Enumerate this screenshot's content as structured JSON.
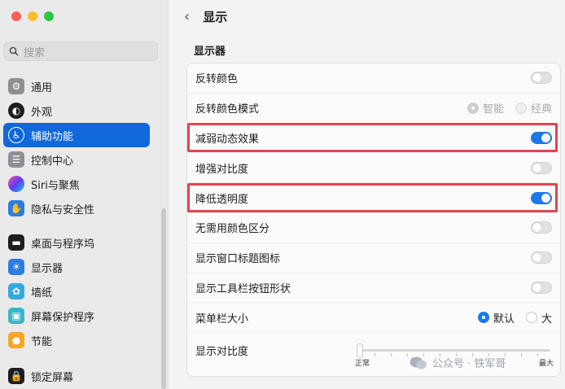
{
  "sidebar": {
    "search_placeholder": "搜索",
    "items": [
      {
        "label": "通用",
        "icon": "gear-icon",
        "color": "#8e8e93"
      },
      {
        "label": "外观",
        "icon": "appearance-icon",
        "color": "#1d1d1f"
      },
      {
        "label": "辅助功能",
        "icon": "accessibility-icon",
        "color": "#1068d9"
      },
      {
        "label": "控制中心",
        "icon": "control-center-icon",
        "color": "#8e8e93"
      },
      {
        "label": "Siri与聚焦",
        "icon": "siri-icon",
        "color": "#6a3fd6"
      },
      {
        "label": "隐私与安全性",
        "icon": "hand-icon",
        "color": "#2a7de1"
      },
      {
        "label": "桌面与程序坞",
        "icon": "dock-icon",
        "color": "#1d1d1f"
      },
      {
        "label": "显示器",
        "icon": "display-icon",
        "color": "#2a7de1"
      },
      {
        "label": "墙纸",
        "icon": "wallpaper-icon",
        "color": "#33aadd"
      },
      {
        "label": "屏幕保护程序",
        "icon": "screensaver-icon",
        "color": "#39b6c9"
      },
      {
        "label": "节能",
        "icon": "bulb-icon",
        "color": "#f5a623"
      },
      {
        "label": "锁定屏幕",
        "icon": "lock-icon",
        "color": "#1d1d1f"
      }
    ],
    "active_index": 2
  },
  "header": {
    "title": "显示"
  },
  "section": {
    "label": "显示器"
  },
  "rows": [
    {
      "label": "反转颜色",
      "type": "toggle",
      "on": false
    },
    {
      "label": "反转颜色模式",
      "type": "radio",
      "options": [
        "智能",
        "经典"
      ]
    },
    {
      "label": "减弱动态效果",
      "type": "toggle",
      "on": true
    },
    {
      "label": "增强对比度",
      "type": "toggle",
      "on": false
    },
    {
      "label": "降低透明度",
      "type": "toggle",
      "on": true
    },
    {
      "label": "无需用颜色区分",
      "type": "toggle",
      "on": false
    },
    {
      "label": "显示窗口标题图标",
      "type": "toggle",
      "on": false
    },
    {
      "label": "显示工具栏按钮形状",
      "type": "toggle",
      "on": false
    },
    {
      "label": "菜单栏大小",
      "type": "radio2",
      "options": [
        "默认",
        "大"
      ]
    },
    {
      "label": "显示对比度",
      "type": "slider",
      "min_label": "正常",
      "max_label": "最大"
    }
  ],
  "watermark": "公众号 · 铁军哥",
  "colors": {
    "accent": "#1a79e6",
    "highlight": "#e0464f"
  }
}
